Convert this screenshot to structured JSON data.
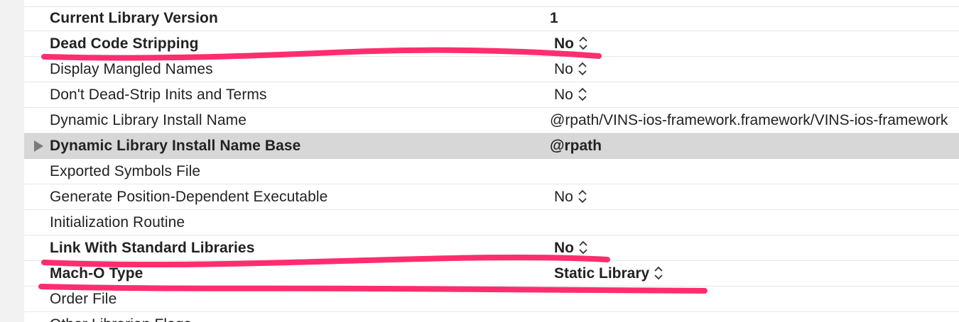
{
  "rows": [
    {
      "name": "",
      "value": "",
      "bold": true
    },
    {
      "name": "Current Library Version",
      "value": "1",
      "bold": true,
      "stepper": false
    },
    {
      "name": "Dead Code Stripping",
      "value": "No",
      "bold": true,
      "stepper": true
    },
    {
      "name": "Display Mangled Names",
      "value": "No",
      "bold": false,
      "stepper": true
    },
    {
      "name": "Don't Dead-Strip Inits and Terms",
      "value": "No",
      "bold": false,
      "stepper": true
    },
    {
      "name": "Dynamic Library Install Name",
      "value": "@rpath/VINS-ios-framework.framework/VINS-ios-framework",
      "bold": false,
      "stepper": false
    },
    {
      "name": "Dynamic Library Install Name Base",
      "value": "@rpath",
      "bold": true,
      "stepper": false,
      "selected": true
    },
    {
      "name": "Exported Symbols File",
      "value": "",
      "bold": false,
      "stepper": false
    },
    {
      "name": "Generate Position-Dependent Executable",
      "value": "No",
      "bold": false,
      "stepper": true
    },
    {
      "name": "Initialization Routine",
      "value": "",
      "bold": false,
      "stepper": false
    },
    {
      "name": "Link With Standard Libraries",
      "value": "No",
      "bold": true,
      "stepper": true
    },
    {
      "name": "Mach-O Type",
      "value": "Static Library",
      "bold": true,
      "stepper": true
    },
    {
      "name": "Order File",
      "value": "",
      "bold": false,
      "stepper": false
    },
    {
      "name": "Other Librarian Flags",
      "value": "",
      "bold": false,
      "stepper": false
    }
  ],
  "colors": {
    "annotation_pink": "#ff2d6f",
    "selected_row": "#d7d7d7",
    "disclosure": "#7a7a7a"
  },
  "icons": {
    "stepper": "up-down-chevron-icon",
    "disclosure": "disclosure-triangle-icon"
  }
}
